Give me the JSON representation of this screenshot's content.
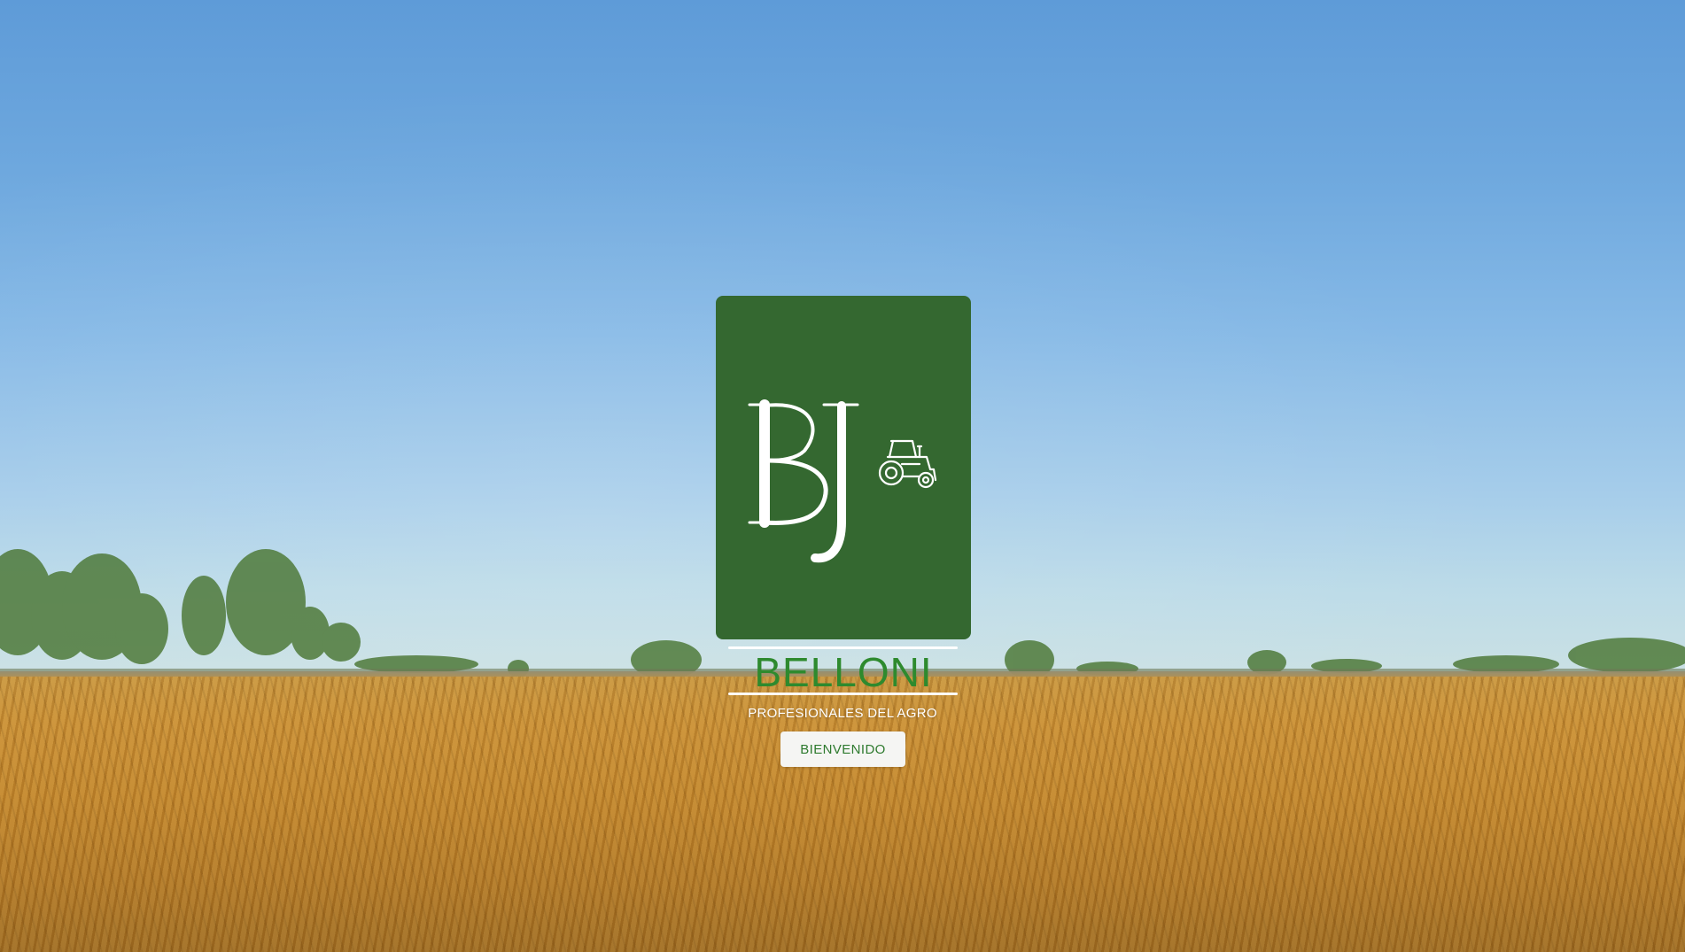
{
  "brand": {
    "monogram": "BJ",
    "name": "BELLONI",
    "tagline": "PROFESIONALES DEL AGRO",
    "logo_icon": "tractor-icon"
  },
  "cta": {
    "label": "BIENVENIDO"
  },
  "background": {
    "scene": "soybean-field-under-blue-sky"
  },
  "colors": {
    "card_green": "#346830",
    "brand_text_green": "#2e8a2e",
    "button_text_green": "#2e7a2e",
    "button_bg": "#f5f5f3",
    "rule_white": "#ffffff"
  }
}
